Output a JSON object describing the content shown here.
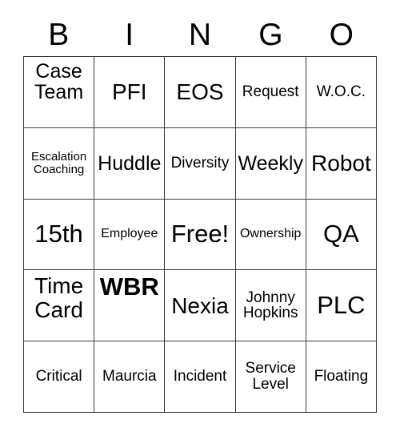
{
  "card": {
    "title": "BINGO",
    "header_letters": [
      "B",
      "I",
      "N",
      "G",
      "O"
    ],
    "grid_line_color": "#3a3a3a",
    "text_color": "#000000",
    "background_color": "#ffffff",
    "rows": 5,
    "columns": 5,
    "cells": [
      [
        {
          "text": "Case Team",
          "size": "lg",
          "align": "top",
          "bold": false
        },
        {
          "text": "PFI",
          "size": "xl",
          "align": "center",
          "bold": false
        },
        {
          "text": "EOS",
          "size": "xl",
          "align": "center",
          "bold": false
        },
        {
          "text": "Request",
          "size": "md",
          "align": "center",
          "bold": false
        },
        {
          "text": "W.O.C.",
          "size": "md",
          "align": "center",
          "bold": false
        }
      ],
      [
        {
          "text": "Escalation Coaching",
          "size": "xs",
          "align": "center",
          "bold": false
        },
        {
          "text": "Huddle",
          "size": "lg",
          "align": "center",
          "bold": false
        },
        {
          "text": "Diversity",
          "size": "md",
          "align": "center",
          "bold": false
        },
        {
          "text": "Weekly",
          "size": "lg",
          "align": "center",
          "bold": false
        },
        {
          "text": "Robot",
          "size": "xl",
          "align": "center",
          "bold": false
        }
      ],
      [
        {
          "text": "15th",
          "size": "xxl",
          "align": "center",
          "bold": false
        },
        {
          "text": "Employee",
          "size": "sm",
          "align": "center",
          "bold": false
        },
        {
          "text": "Free!",
          "size": "xxl",
          "align": "center",
          "bold": false
        },
        {
          "text": "Ownership",
          "size": "sm",
          "align": "center",
          "bold": false
        },
        {
          "text": "QA",
          "size": "xxl",
          "align": "center",
          "bold": false
        }
      ],
      [
        {
          "text": "Time Card",
          "size": "xl",
          "align": "top",
          "bold": false
        },
        {
          "text": "WBR",
          "size": "xxl",
          "align": "top",
          "bold": true
        },
        {
          "text": "Nexia",
          "size": "xl",
          "align": "center",
          "bold": false
        },
        {
          "text": "Johnny Hopkins",
          "size": "md",
          "align": "center",
          "bold": false
        },
        {
          "text": "PLC",
          "size": "xxl",
          "align": "center",
          "bold": false
        }
      ],
      [
        {
          "text": "Critical",
          "size": "md",
          "align": "center",
          "bold": false
        },
        {
          "text": "Maurcia",
          "size": "md",
          "align": "center",
          "bold": false
        },
        {
          "text": "Incident",
          "size": "md",
          "align": "center",
          "bold": false
        },
        {
          "text": "Service Level",
          "size": "md",
          "align": "center",
          "bold": false
        },
        {
          "text": "Floating",
          "size": "md",
          "align": "center",
          "bold": false
        }
      ]
    ]
  }
}
